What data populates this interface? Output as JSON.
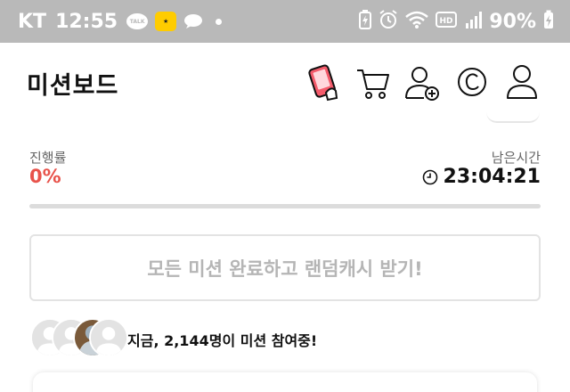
{
  "status_bar": {
    "carrier": "KT",
    "time": "12:55",
    "talk_label": "TALK",
    "battery_percent": "90%"
  },
  "header": {
    "title": "미션보드",
    "icons": [
      "phone-mission-icon",
      "cart-icon",
      "add-friend-icon",
      "cash-icon",
      "profile-icon"
    ]
  },
  "progress": {
    "label": "진행률",
    "percent_text": "0%",
    "value": 0,
    "remaining_label": "남은시간",
    "remaining_time": "23:04:21"
  },
  "cta": {
    "label": "모든 미션 완료하고 랜덤캐시 받기!"
  },
  "participants": {
    "prefix": "지금, ",
    "count": "2,144명",
    "suffix": "이 미션 참여중!"
  },
  "colors": {
    "accent": "#e8534b",
    "status_bar_bg": "#b9b9b9",
    "cta_text": "#b5b5b5",
    "border": "#e3e3e3"
  }
}
